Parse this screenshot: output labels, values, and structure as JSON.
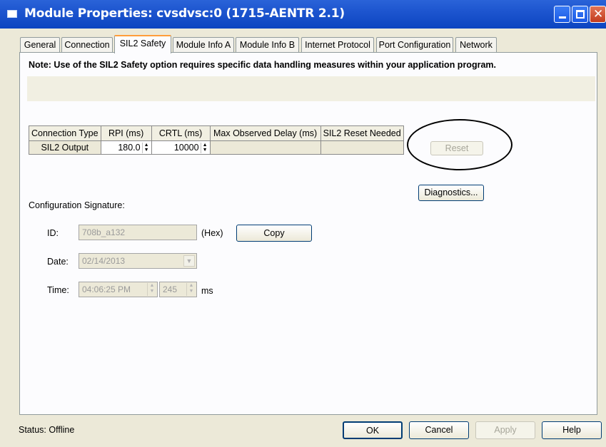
{
  "window": {
    "title": "Module Properties: cvsdvsc:0 (1715-AENTR 2.1)"
  },
  "tabs": [
    {
      "label": "General"
    },
    {
      "label": "Connection"
    },
    {
      "label": "SIL2 Safety"
    },
    {
      "label": "Module Info A"
    },
    {
      "label": "Module Info B"
    },
    {
      "label": "Internet Protocol"
    },
    {
      "label": "Port Configuration"
    },
    {
      "label": "Network"
    }
  ],
  "active_tab": "SIL2 Safety",
  "note": "Note: Use of the SIL2 Safety option requires specific data handling measures within your application program.",
  "connection_table": {
    "headers": [
      "Connection Type",
      "RPI (ms)",
      "CRTL (ms)",
      "Max Observed Delay (ms)",
      "SIL2 Reset Needed"
    ],
    "rows": [
      {
        "type": "SIL2 Output",
        "rpi": "180.0",
        "crtl": "10000",
        "max_delay": "",
        "reset_needed": ""
      }
    ]
  },
  "buttons": {
    "reset": "Reset",
    "diagnostics": "Diagnostics...",
    "copy": "Copy"
  },
  "config": {
    "heading": "Configuration Signature:",
    "id_label": "ID:",
    "id_value": "708b_a132",
    "hex_label": "(Hex)",
    "date_label": "Date:",
    "date_value": "02/14/2013",
    "time_label": "Time:",
    "time_value": "04:06:25 PM",
    "ms_value": "245",
    "ms_label": "ms"
  },
  "footer": {
    "status": "Status:  Offline",
    "ok": "OK",
    "cancel": "Cancel",
    "apply": "Apply",
    "help": "Help"
  }
}
